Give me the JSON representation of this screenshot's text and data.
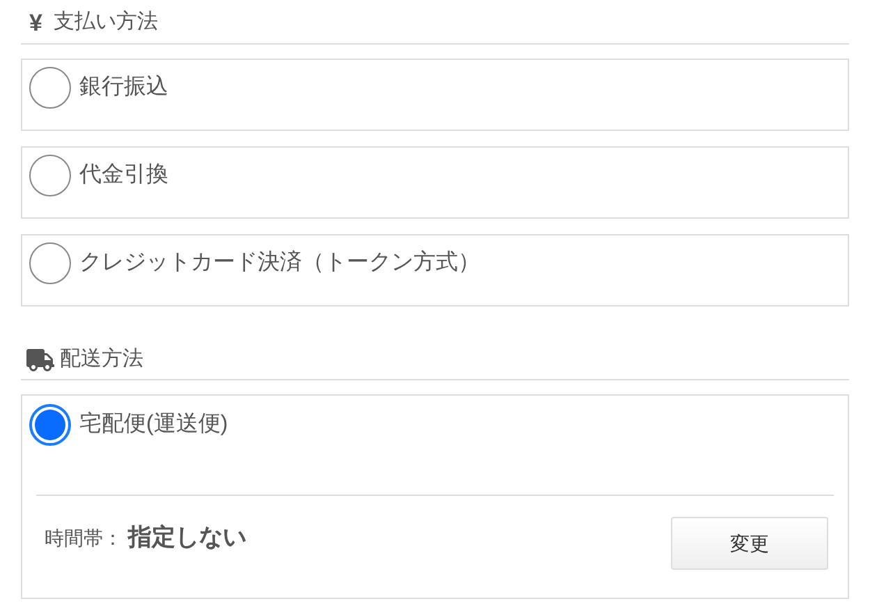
{
  "payment": {
    "icon": "¥",
    "title": "支払い方法",
    "options": [
      {
        "label": "銀行振込",
        "selected": false
      },
      {
        "label": "代金引換",
        "selected": false
      },
      {
        "label": "クレジットカード決済（トークン方式）",
        "selected": false
      }
    ]
  },
  "delivery": {
    "title": "配送方法",
    "options": [
      {
        "label": "宅配便(運送便)",
        "selected": true,
        "time_label": "時間帯：",
        "time_value": "指定しない",
        "button": "変更"
      }
    ]
  }
}
